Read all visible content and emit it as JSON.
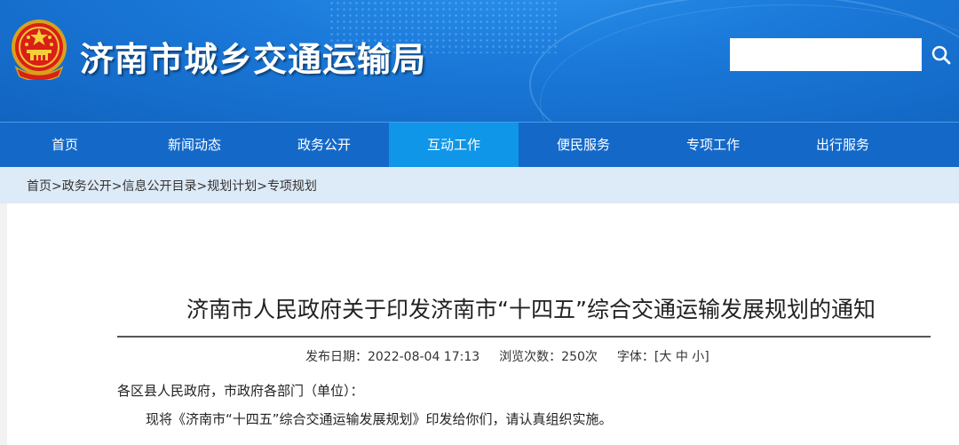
{
  "header": {
    "title": "济南市城乡交通运输局",
    "emblem_icon": "national-emblem-icon",
    "search": {
      "placeholder": "",
      "icon": "search-icon"
    }
  },
  "nav": {
    "items": [
      {
        "label": "首页"
      },
      {
        "label": "新闻动态"
      },
      {
        "label": "政务公开"
      },
      {
        "label": "互动工作",
        "active": true
      },
      {
        "label": "便民服务"
      },
      {
        "label": "专项工作"
      },
      {
        "label": "出行服务"
      }
    ]
  },
  "breadcrumb": {
    "items": [
      "首页",
      "政务公开",
      "信息公开目录",
      "规划计划",
      "专项规划"
    ],
    "separator": ">"
  },
  "article": {
    "title": "济南市人民政府关于印发济南市“十四五”综合交通运输发展规划的通知",
    "meta": {
      "date_label": "发布日期：",
      "date": "2022-08-04  17:13",
      "views_label": "浏览次数：",
      "views": "250次",
      "font_label": "字体：",
      "font_open": "[",
      "font_large": "大",
      "font_medium": "中",
      "font_small": "小",
      "font_close": "]"
    },
    "salutation": "各区县人民政府，市政府各部门（单位）：",
    "body": "现将《济南市“十四五”综合交通运输发展规划》印发给你们，请认真组织实施。"
  },
  "colors": {
    "header_blue": "#1a78d8",
    "nav_blue": "#1469c8",
    "nav_active": "#0f96e8",
    "breadcrumb_bg": "#ddeaf7"
  }
}
